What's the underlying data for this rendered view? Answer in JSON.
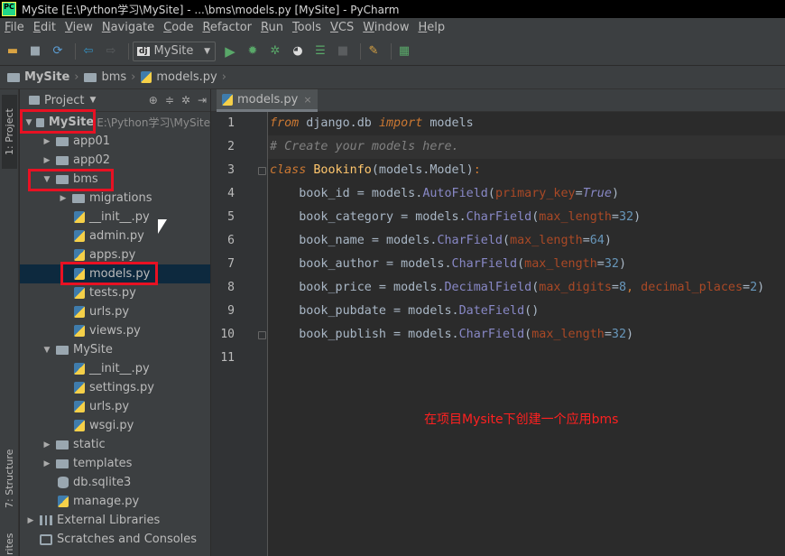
{
  "window": {
    "title": "MySite [E:\\Python学习\\MySite] - ...\\bms\\models.py [MySite] - PyCharm",
    "logo_text": "PC"
  },
  "menu": [
    {
      "label": "File",
      "mnemonic": "F",
      "rest": "ile"
    },
    {
      "label": "Edit",
      "mnemonic": "E",
      "rest": "dit"
    },
    {
      "label": "View",
      "mnemonic": "V",
      "rest": "iew"
    },
    {
      "label": "Navigate",
      "mnemonic": "N",
      "rest": "avigate"
    },
    {
      "label": "Code",
      "mnemonic": "C",
      "rest": "ode"
    },
    {
      "label": "Refactor",
      "mnemonic": "R",
      "rest": "efactor"
    },
    {
      "label": "Run",
      "mnemonic": "R",
      "rest": "un"
    },
    {
      "label": "Tools",
      "mnemonic": "T",
      "rest": "ools"
    },
    {
      "label": "VCS",
      "mnemonic": "V",
      "rest": "CS"
    },
    {
      "label": "Window",
      "mnemonic": "W",
      "rest": "indow"
    },
    {
      "label": "Help",
      "mnemonic": "H",
      "rest": "elp"
    }
  ],
  "toolbar": {
    "run_config_badge": "dj",
    "run_config": "MySite"
  },
  "breadcrumb": [
    "MySite",
    "bms",
    "models.py"
  ],
  "tool_windows": {
    "project": "1: Project",
    "structure": "7: Structure",
    "favorites": "rites"
  },
  "project_panel": {
    "title": "Project",
    "root_path": "E:\\Python学习\\MySite",
    "tree": [
      {
        "label": "MySite",
        "kind": "folder",
        "arrow": "▼",
        "bold": true
      },
      {
        "label": "app01",
        "kind": "folder",
        "arrow": "▶"
      },
      {
        "label": "app02",
        "kind": "folder",
        "arrow": "▶"
      },
      {
        "label": "bms",
        "kind": "folder",
        "arrow": "▼"
      },
      {
        "label": "migrations",
        "kind": "folder",
        "arrow": "▶"
      },
      {
        "label": "__init__.py",
        "kind": "python"
      },
      {
        "label": "admin.py",
        "kind": "python"
      },
      {
        "label": "apps.py",
        "kind": "python"
      },
      {
        "label": "models.py",
        "kind": "python",
        "selected": true
      },
      {
        "label": "tests.py",
        "kind": "python"
      },
      {
        "label": "urls.py",
        "kind": "python"
      },
      {
        "label": "views.py",
        "kind": "python"
      },
      {
        "label": "MySite",
        "kind": "folder",
        "arrow": "▼"
      },
      {
        "label": "__init__.py",
        "kind": "python"
      },
      {
        "label": "settings.py",
        "kind": "python"
      },
      {
        "label": "urls.py",
        "kind": "python"
      },
      {
        "label": "wsgi.py",
        "kind": "python"
      },
      {
        "label": "static",
        "kind": "folder",
        "arrow": "▶"
      },
      {
        "label": "templates",
        "kind": "folder",
        "arrow": "▶"
      },
      {
        "label": "db.sqlite3",
        "kind": "database"
      },
      {
        "label": "manage.py",
        "kind": "python"
      },
      {
        "label": "External Libraries",
        "kind": "library",
        "arrow": "▶"
      },
      {
        "label": "Scratches and Consoles",
        "kind": "scratch"
      }
    ]
  },
  "editor": {
    "tab_label": "models.py",
    "tab_close": "×",
    "line_numbers": [
      "1",
      "2",
      "3",
      "4",
      "5",
      "6",
      "7",
      "8",
      "9",
      "10",
      "11"
    ],
    "current_line": 2,
    "lines": [
      [
        {
          "t": "from",
          "c": "kw"
        },
        {
          "t": " django.db ",
          "c": ""
        },
        {
          "t": "import",
          "c": "kw"
        },
        {
          "t": " models",
          "c": ""
        }
      ],
      [
        {
          "t": "# Create your models here.",
          "c": "cmt"
        }
      ],
      [
        {
          "t": "class",
          "c": "kw"
        },
        {
          "t": " ",
          "c": ""
        },
        {
          "t": "Bookinfo",
          "c": "cls"
        },
        {
          "t": "(models.Model)",
          "c": ""
        },
        {
          "t": ":",
          "c": "kwc"
        }
      ],
      [
        {
          "t": "    book_id = models.",
          "c": ""
        },
        {
          "t": "AutoField",
          "c": "fn"
        },
        {
          "t": "(",
          "c": ""
        },
        {
          "t": "primary_key",
          "c": "param"
        },
        {
          "t": "=",
          "c": ""
        },
        {
          "t": "True",
          "c": "tru"
        },
        {
          "t": ")",
          "c": ""
        }
      ],
      [
        {
          "t": "    book_category = models.",
          "c": ""
        },
        {
          "t": "CharField",
          "c": "fn"
        },
        {
          "t": "(",
          "c": ""
        },
        {
          "t": "max_length",
          "c": "param"
        },
        {
          "t": "=",
          "c": ""
        },
        {
          "t": "32",
          "c": "num"
        },
        {
          "t": ")",
          "c": ""
        }
      ],
      [
        {
          "t": "    book_name = models.",
          "c": ""
        },
        {
          "t": "CharField",
          "c": "fn"
        },
        {
          "t": "(",
          "c": ""
        },
        {
          "t": "max_length",
          "c": "param"
        },
        {
          "t": "=",
          "c": ""
        },
        {
          "t": "64",
          "c": "num"
        },
        {
          "t": ")",
          "c": ""
        }
      ],
      [
        {
          "t": "    book_author = models.",
          "c": ""
        },
        {
          "t": "CharField",
          "c": "fn"
        },
        {
          "t": "(",
          "c": ""
        },
        {
          "t": "max_length",
          "c": "param"
        },
        {
          "t": "=",
          "c": ""
        },
        {
          "t": "32",
          "c": "num"
        },
        {
          "t": ")",
          "c": ""
        }
      ],
      [
        {
          "t": "    book_price = models.",
          "c": ""
        },
        {
          "t": "DecimalField",
          "c": "fn"
        },
        {
          "t": "(",
          "c": ""
        },
        {
          "t": "max_digits",
          "c": "param"
        },
        {
          "t": "=",
          "c": ""
        },
        {
          "t": "8",
          "c": "num"
        },
        {
          "t": ", ",
          "c": "kwc"
        },
        {
          "t": "decimal_places",
          "c": "param"
        },
        {
          "t": "=",
          "c": ""
        },
        {
          "t": "2",
          "c": "num"
        },
        {
          "t": ")",
          "c": ""
        }
      ],
      [
        {
          "t": "    book_pubdate = models.",
          "c": ""
        },
        {
          "t": "DateField",
          "c": "fn"
        },
        {
          "t": "()",
          "c": ""
        }
      ],
      [
        {
          "t": "    book_publish = models.",
          "c": ""
        },
        {
          "t": "CharField",
          "c": "fn"
        },
        {
          "t": "(",
          "c": ""
        },
        {
          "t": "max_length",
          "c": "param"
        },
        {
          "t": "=",
          "c": ""
        },
        {
          "t": "32",
          "c": "num"
        },
        {
          "t": ")",
          "c": ""
        }
      ],
      []
    ],
    "annotation": "在项目Mysite下创建一个应用bms"
  },
  "colors": {
    "highlight_box": "#e81123",
    "selection": "#0d293e",
    "annotation": "#ff2020"
  }
}
